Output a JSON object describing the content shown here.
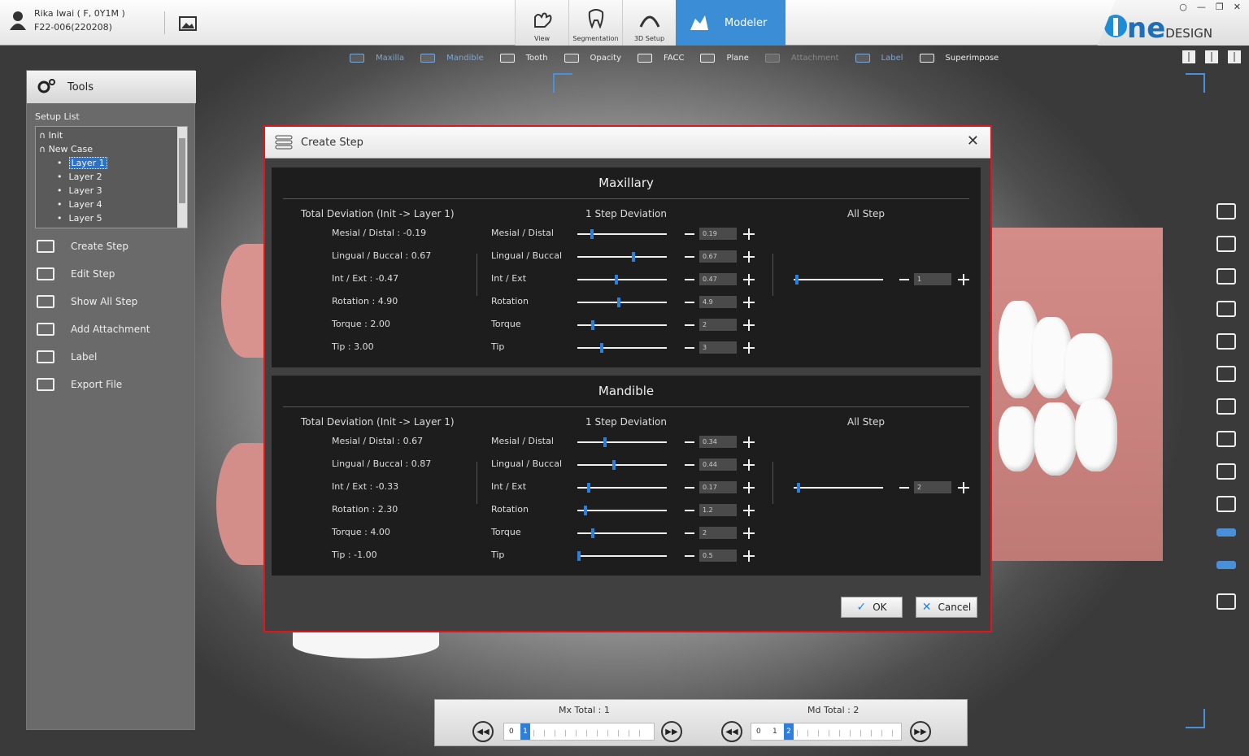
{
  "patient": {
    "name": "Rika Iwai ( F, 0Y1M )",
    "id": "F22-006(220208)"
  },
  "main_tabs": [
    {
      "label": "View",
      "icon": "hand-icon"
    },
    {
      "label": "Segmentation",
      "icon": "tooth-icon"
    },
    {
      "label": "3D Setup",
      "icon": "arch-icon"
    }
  ],
  "active_tab": "Modeler",
  "logo": {
    "text": "ne",
    "suffix": "DESIGN"
  },
  "subtoolbar": [
    {
      "label": "Maxilla",
      "style": "dim"
    },
    {
      "label": "Mandible",
      "style": "dim"
    },
    {
      "label": "Tooth",
      "style": "normal"
    },
    {
      "label": "Opacity",
      "style": "normal"
    },
    {
      "label": "FACC",
      "style": "normal"
    },
    {
      "label": "Plane",
      "style": "normal"
    },
    {
      "label": "Attachment",
      "style": "gray"
    },
    {
      "label": "Label",
      "style": "dim"
    },
    {
      "label": "Superimpose",
      "style": "normal"
    }
  ],
  "tools": {
    "title": "Tools",
    "setup_list_label": "Setup List",
    "setup_list": {
      "init": "Init",
      "new_case": "New Case",
      "layers": [
        "Layer 1",
        "Layer 2",
        "Layer 3",
        "Layer 4",
        "Layer 5"
      ]
    },
    "menu": [
      "Create Step",
      "Edit Step",
      "Show All Step",
      "Add Attachment",
      "Label",
      "Export File"
    ]
  },
  "dialog": {
    "title": "Create Step",
    "close": "✕",
    "sections": [
      {
        "title": "Maxillary",
        "total_header": "Total Deviation (Init -> Layer 1)",
        "step_header": "1 Step Deviation",
        "all_header": "All Step",
        "totals": [
          "Mesial / Distal : -0.19",
          "Lingual / Buccal : 0.67",
          "Int / Ext : -0.47",
          "Rotation : 4.90",
          "Torque : 2.00",
          "Tip : 3.00"
        ],
        "params": [
          {
            "label": "Mesial / Distal",
            "value": "0.19",
            "slider": 0.16
          },
          {
            "label": "Lingual / Buccal",
            "value": "0.67",
            "slider": 0.63
          },
          {
            "label": "Int / Ext",
            "value": "0.47",
            "slider": 0.44
          },
          {
            "label": "Rotation",
            "value": "4.9",
            "slider": 0.46
          },
          {
            "label": "Torque",
            "value": "2",
            "slider": 0.17
          },
          {
            "label": "Tip",
            "value": "3",
            "slider": 0.27
          }
        ],
        "all_step": {
          "value": "1",
          "slider": 0.04
        }
      },
      {
        "title": "Mandible",
        "total_header": "Total Deviation (Init -> Layer 1)",
        "step_header": "1 Step Deviation",
        "all_header": "All Step",
        "totals": [
          "Mesial / Distal : 0.67",
          "Lingual / Buccal : 0.87",
          "Int / Ext : -0.33",
          "Rotation : 2.30",
          "Torque : 4.00",
          "Tip : -1.00"
        ],
        "params": [
          {
            "label": "Mesial / Distal",
            "value": "0.34",
            "slider": 0.31
          },
          {
            "label": "Lingual / Buccal",
            "value": "0.44",
            "slider": 0.41
          },
          {
            "label": "Int / Ext",
            "value": "0.17",
            "slider": 0.13
          },
          {
            "label": "Rotation",
            "value": "1.2",
            "slider": 0.09
          },
          {
            "label": "Torque",
            "value": "2",
            "slider": 0.17
          },
          {
            "label": "Tip",
            "value": "0.5",
            "slider": 0.02
          }
        ],
        "all_step": {
          "value": "2",
          "slider": 0.05
        }
      }
    ],
    "ok": "OK",
    "cancel": "Cancel"
  },
  "bottom": {
    "mx_label": "Mx Total : 1",
    "md_label": "Md Total : 2",
    "mx_track": {
      "start": "0",
      "current": "1"
    },
    "md_track": {
      "start": "0",
      "mid": "1",
      "current": "2"
    },
    "prev_icon": "rewind-icon",
    "next_icon": "fast-forward-icon"
  },
  "colors": {
    "accent": "#3b8ed6",
    "highlight_border": "#e0161c",
    "slider_thumb": "#2e7fd9"
  }
}
